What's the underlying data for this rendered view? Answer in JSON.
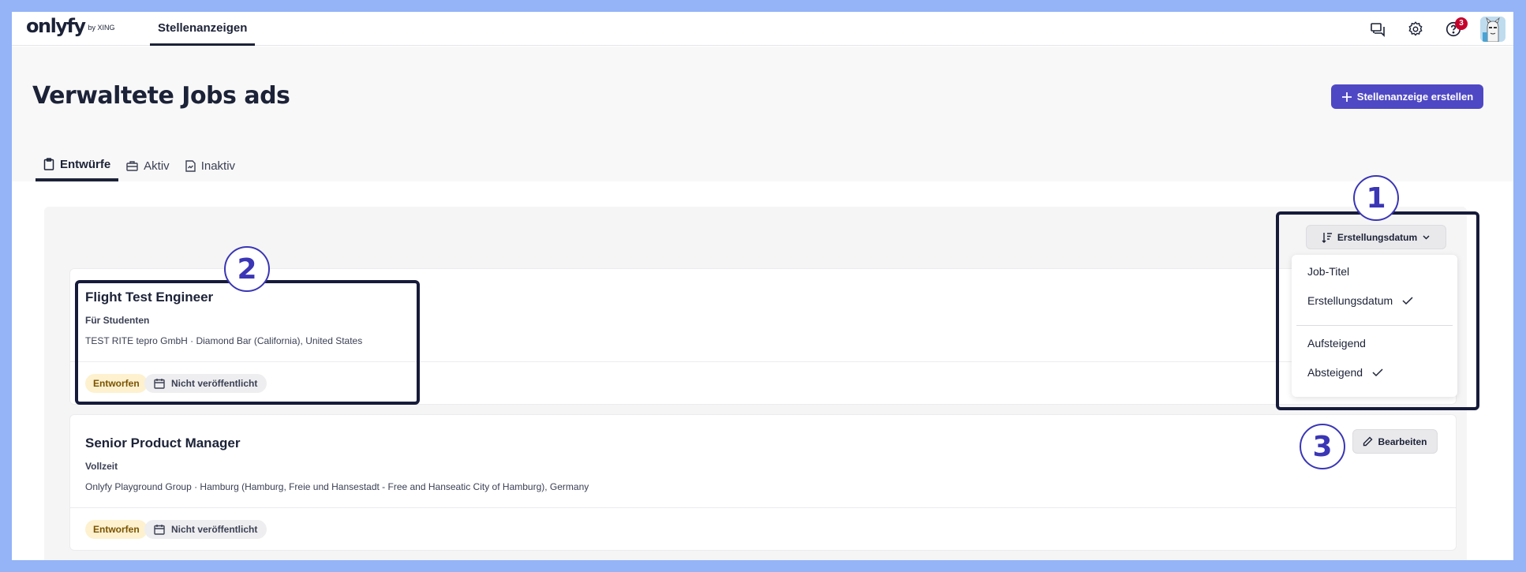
{
  "brand": {
    "logo": "onlyfy",
    "by": "by XING"
  },
  "nav": {
    "tab_label": "Stellenanzeigen",
    "notifications_count": "3"
  },
  "header": {
    "title": "Verwaltete Jobs ads",
    "create_button": "Stellenanzeige erstellen",
    "tabs": [
      {
        "label": "Entwürfe",
        "icon": "clipboard-icon",
        "active": true
      },
      {
        "label": "Aktiv",
        "icon": "briefcase-icon",
        "active": false
      },
      {
        "label": "Inaktiv",
        "icon": "document-chart-icon",
        "active": false
      }
    ]
  },
  "sort": {
    "button_label": "Erstellungsdatum",
    "options": [
      {
        "label": "Job-Titel",
        "selected": false
      },
      {
        "label": "Erstellungsdatum",
        "selected": true
      }
    ],
    "order_options": [
      {
        "label": "Aufsteigend",
        "selected": false
      },
      {
        "label": "Absteigend",
        "selected": true
      }
    ]
  },
  "jobs": [
    {
      "title": "Flight Test Engineer",
      "type": "Für Studenten",
      "location": "TEST RITE tepro GmbH · Diamond Bar (California), United States",
      "status": "Entworfen",
      "publish_state": "Nicht veröffentlicht"
    },
    {
      "title": "Senior Product Manager",
      "type": "Vollzeit",
      "location": "Onlyfy Playground Group · Hamburg (Hamburg, Freie und Hansestadt - Free and Hanseatic City of Hamburg), Germany",
      "status": "Entworfen",
      "publish_state": "Nicht veröffentlicht",
      "edit_label": "Bearbeiten"
    }
  ],
  "annotations": [
    "1",
    "2",
    "3"
  ],
  "colors": {
    "accent": "#4f48c4",
    "frame": "#94b4f7",
    "draft_badge": "#fdf1cf"
  }
}
